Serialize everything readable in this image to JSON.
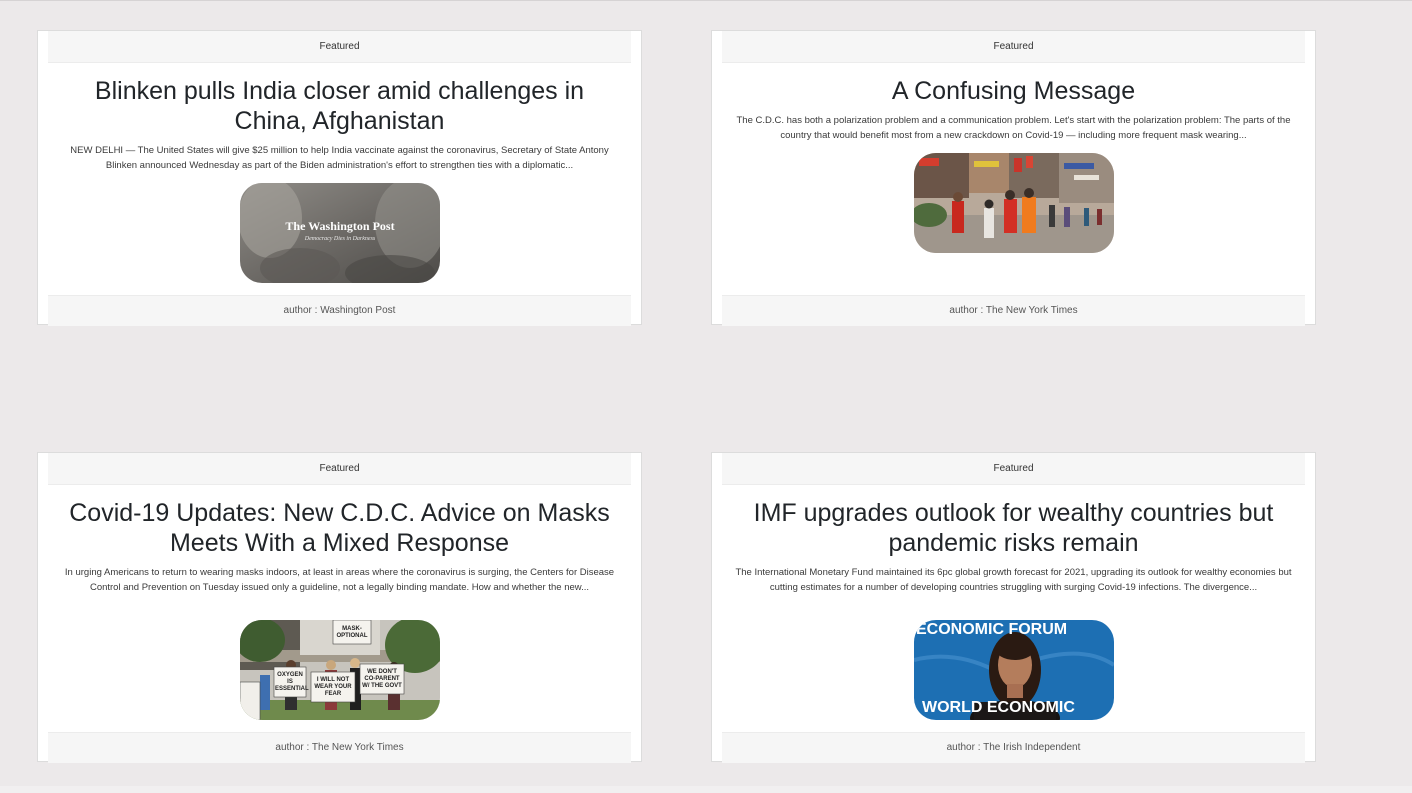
{
  "cards": [
    {
      "header": "Featured",
      "title": "Blinken pulls India closer amid challenges in China, Afghanistan",
      "description": "NEW DELHI — The United States will give $25 million to help India vaccinate against the coronavirus, Secretary of State Antony Blinken announced Wednesday as part of the Biden administration's effort to strengthen ties with a diplomatic...",
      "image": {
        "name": "washington-post-logo-image",
        "brand": "The Washington Post",
        "slogan": "Democracy Dies in Darkness"
      },
      "footer": "author : Washington Post"
    },
    {
      "header": "Featured",
      "title": "A Confusing Message",
      "description": "The C.D.C. has both a polarization problem and a communication problem. Let's start with the polarization problem: The parts of the country that would benefit most from a new crackdown on Covid-19 — including more frequent mask wearing...",
      "image": {
        "name": "street-vaccination-image"
      },
      "footer": "author : The New York Times"
    },
    {
      "header": "Featured",
      "title": "Covid-19 Updates: New C.D.C. Advice on Masks Meets With a Mixed Response",
      "description": "In urging Americans to return to wearing masks indoors, at least in areas where the coronavirus is surging, the Centers for Disease Control and Prevention on Tuesday issued only a guideline, not a legally binding mandate. How and whether the new...",
      "image": {
        "name": "mask-protest-image",
        "signs": [
          "MASK-OPTIONAL",
          "OXYGEN IS ESSENTIAL",
          "I WILL NOT WEAR YOUR FEAR",
          "WE DON'T CO-PARENT W/ THE GOVT"
        ]
      },
      "footer": "author : The New York Times"
    },
    {
      "header": "Featured",
      "title": "IMF upgrades outlook for wealthy countries but pandemic risks remain",
      "description": "The International Monetary Fund maintained its 6pc global growth forecast for 2021, upgrading its outlook for wealthy economies but cutting estimates for a number of developing countries struggling with surging Covid-19 infections. The divergence...",
      "image": {
        "name": "economic-forum-speaker-image",
        "backdrop_top": "ECONOMIC FORUM",
        "backdrop_bottom": "WORLD ECONOMIC"
      },
      "footer": "author : The Irish Independent"
    }
  ]
}
